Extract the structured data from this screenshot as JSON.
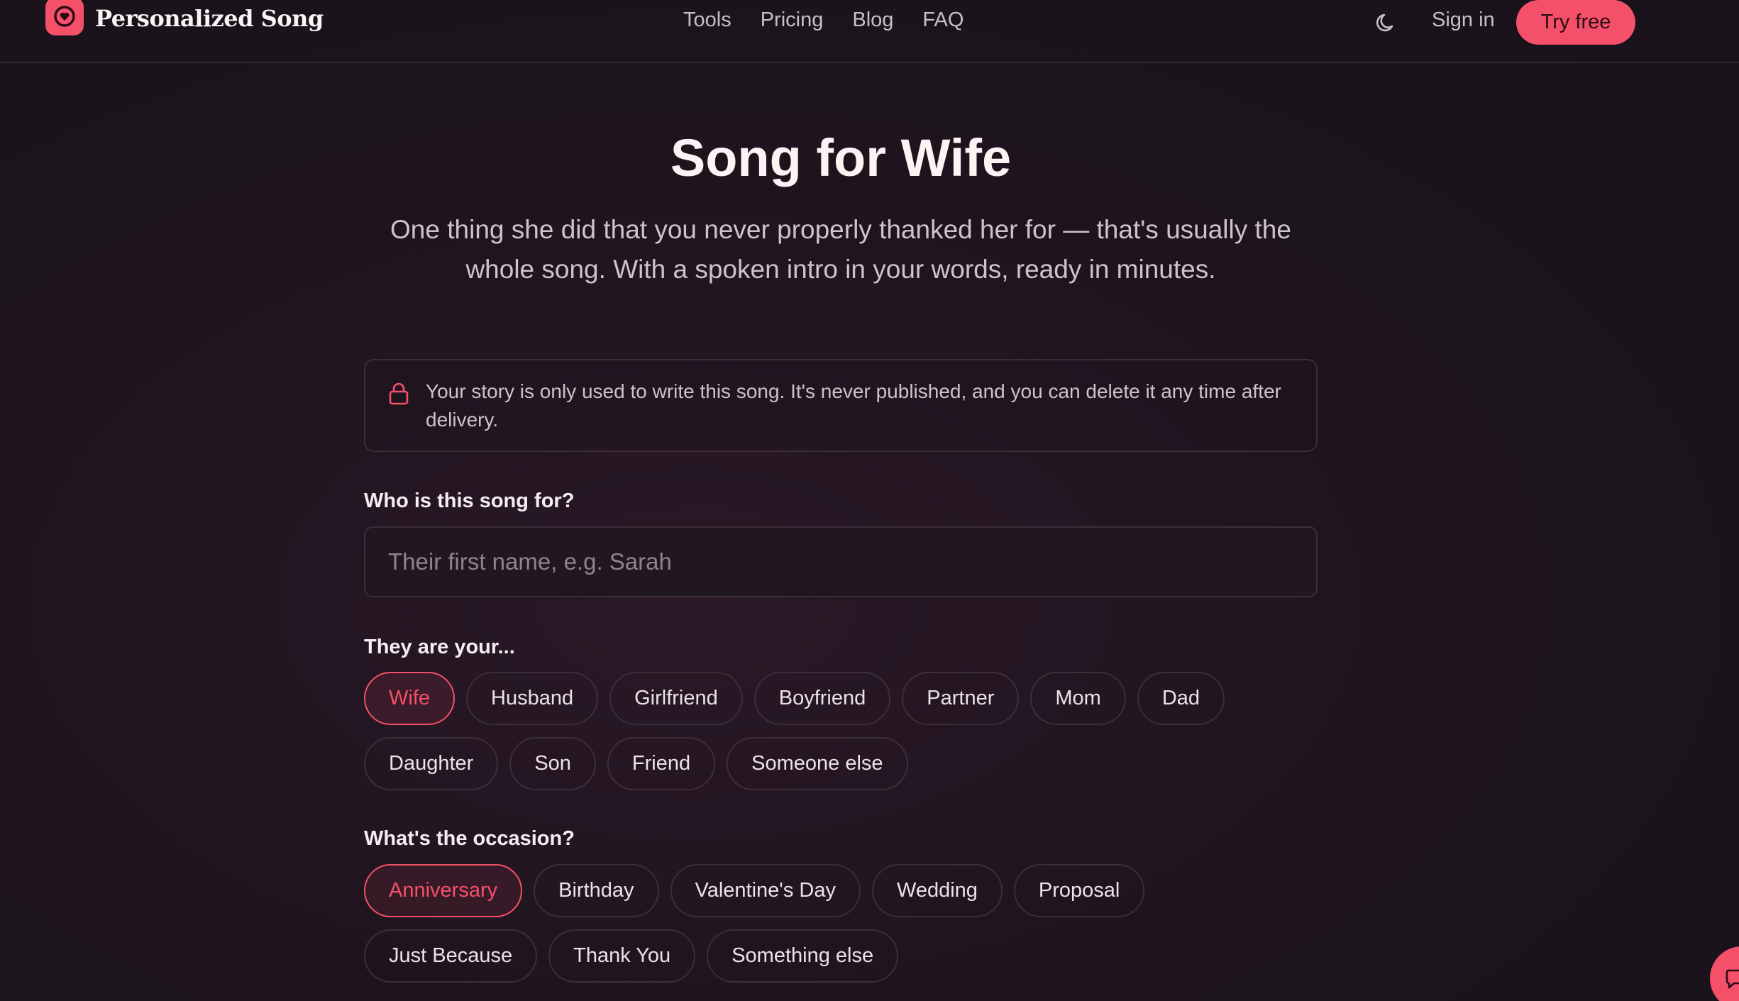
{
  "header": {
    "brand": "Personalized Song",
    "nav": [
      "Tools",
      "Pricing",
      "Blog",
      "FAQ"
    ],
    "sign_in": "Sign in",
    "try_free": "Try free",
    "icons": {
      "logo": "heart-icon",
      "theme": "moon-icon"
    }
  },
  "hero": {
    "title": "Song for Wife",
    "subtitle": "One thing she did that you never properly thanked her for — that's usually the whole song. With a spoken intro in your words, ready in minutes."
  },
  "privacy": {
    "icon": "lock-icon",
    "text": "Your story is only used to write this song. It's never published, and you can delete it any time after delivery."
  },
  "form": {
    "recipient_label": "Who is this song for?",
    "recipient_placeholder": "Their first name, e.g. Sarah",
    "recipient_value": "",
    "relation_label": "They are your...",
    "relations": [
      "Wife",
      "Husband",
      "Girlfriend",
      "Boyfriend",
      "Partner",
      "Mom",
      "Dad",
      "Daughter",
      "Son",
      "Friend",
      "Someone else"
    ],
    "relation_selected": "Wife",
    "occasion_label": "What's the occasion?",
    "occasions": [
      "Anniversary",
      "Birthday",
      "Valentine's Day",
      "Wedding",
      "Proposal",
      "Just Because",
      "Thank You",
      "Something else"
    ],
    "occasion_selected": "Anniversary"
  },
  "chat": {
    "icon": "chat-icon"
  },
  "colors": {
    "accent": "#f5506a",
    "background": "#1d141d",
    "border": "#3a2f39"
  }
}
